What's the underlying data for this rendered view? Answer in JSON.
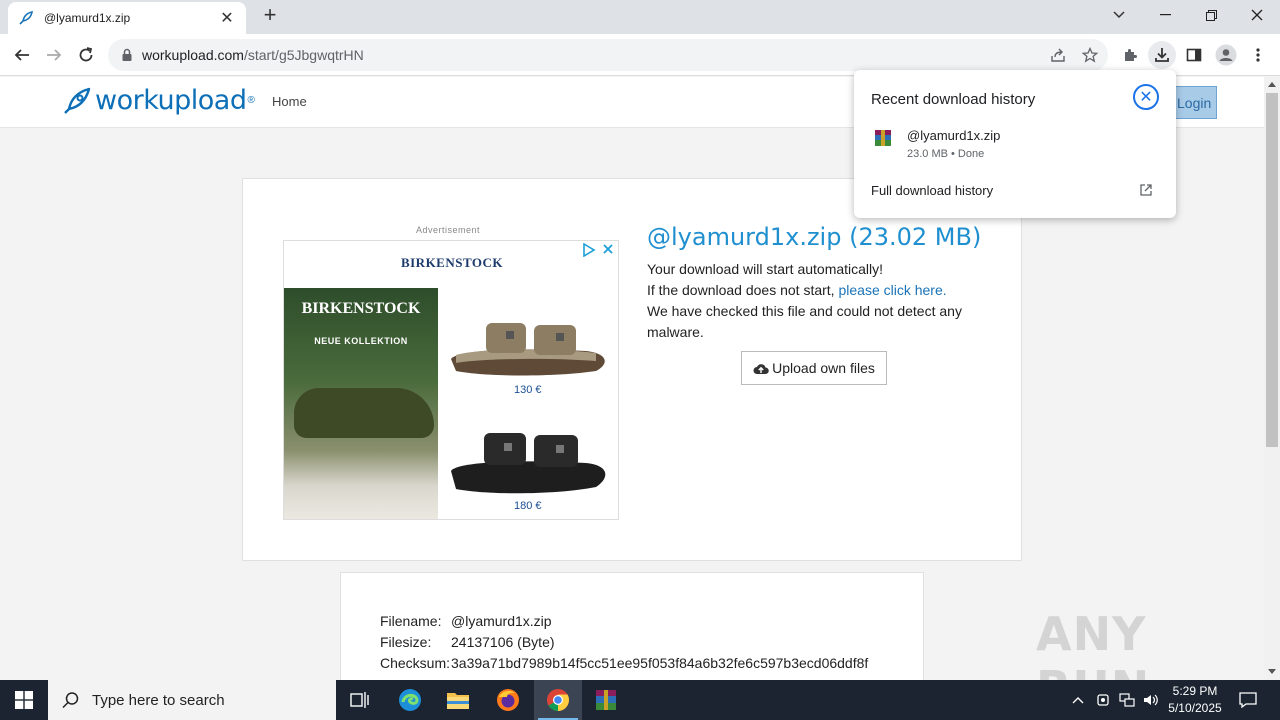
{
  "browser": {
    "tab_title": "@lyamurd1x.zip",
    "tab_close": "✕",
    "new_tab": "+",
    "url_domain": "workupload.com",
    "url_path": "/start/g5JbgwqtrHN"
  },
  "site": {
    "logo_text": "workupload",
    "logo_reg": "®",
    "nav_home": "Home",
    "login_label": "Login"
  },
  "ad": {
    "label": "Advertisement",
    "brand": "BIRKENSTOCK",
    "photo_brand": "BIRKENSTOCK",
    "photo_tagline": "NEUE KOLLEKTION",
    "price1": "130 €",
    "price2": "180 €"
  },
  "file": {
    "title": "@lyamurd1x.zip (23.02 MB)",
    "line1": "Your download will start automatically!",
    "line2_prefix": "If the download does not start, ",
    "line2_link": "please click here.",
    "line3": "We have checked this file and could not detect any malware.",
    "upload_label": "Upload own files"
  },
  "details": {
    "filename_label": "Filename:",
    "filename_value": "@lyamurd1x.zip",
    "filesize_label": "Filesize:",
    "filesize_value": "24137106 (Byte)",
    "checksum_label": "Checksum:",
    "checksum_value": "3a39a71bd7989b14f5cc51ee95f053f84a6b32fe6c597b3ecd06ddf8f"
  },
  "download_popup": {
    "header": "Recent download history",
    "file_name": "@lyamurd1x.zip",
    "file_meta": "23.0 MB • Done",
    "full_history": "Full download history"
  },
  "watermark": "ANY RUN",
  "taskbar": {
    "search_placeholder": "Type here to search",
    "time": "5:29 PM",
    "date": "5/10/2025"
  },
  "colors": {
    "accent_blue": "#1a73e8",
    "brand_blue": "#0d6fb8",
    "title_blue": "#1f8fd0"
  }
}
